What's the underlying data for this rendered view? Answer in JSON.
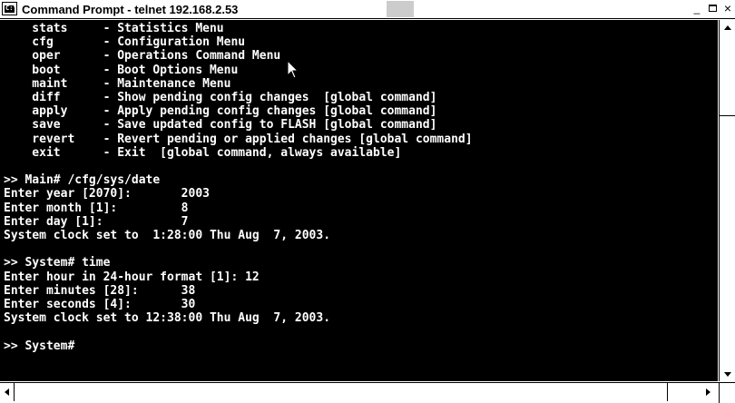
{
  "window": {
    "title": "Command Prompt - telnet 192.168.2.53",
    "icon": "command-prompt-icon",
    "icon_glyph": "C:\\",
    "buttons": {
      "minimize": "_",
      "maximize": "□",
      "close": "×"
    }
  },
  "console": {
    "background": "#000000",
    "foreground": "#ffffff",
    "text": "    stats     - Statistics Menu\n    cfg       - Configuration Menu\n    oper      - Operations Command Menu\n    boot      - Boot Options Menu\n    maint     - Maintenance Menu\n    diff      - Show pending config changes  [global command]\n    apply     - Apply pending config changes [global command]\n    save      - Save updated config to FLASH [global command]\n    revert    - Revert pending or applied changes [global command]\n    exit      - Exit  [global command, always available]\n\n>> Main# /cfg/sys/date\nEnter year [2070]:       2003\nEnter month [1]:         8\nEnter day [1]:           7\nSystem clock set to  1:28:00 Thu Aug  7, 2003.\n\n>> System# time\nEnter hour in 24-hour format [1]: 12\nEnter minutes [28]:      38\nEnter seconds [4]:       30\nSystem clock set to 12:38:00 Thu Aug  7, 2003.\n\n>> System#"
  },
  "cursor": "mouse-pointer-icon",
  "scrollbars": {
    "vertical_up": "arrow-up-icon",
    "vertical_down": "arrow-down-icon",
    "horizontal_left": "arrow-left-icon",
    "horizontal_right": "arrow-right-icon"
  }
}
